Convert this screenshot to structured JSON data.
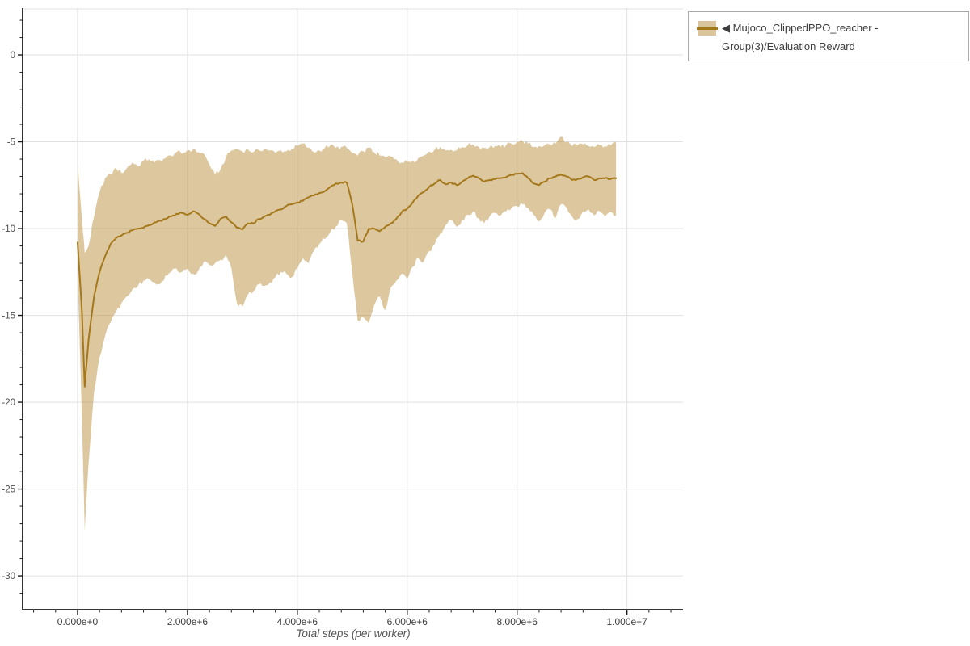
{
  "legend": {
    "icon": "◀",
    "label": "Mujoco_ClippedPPO_reacher - Group(3)/Evaluation Reward"
  },
  "chart_data": {
    "type": "line",
    "title": "",
    "xlabel": "Total steps (per worker)",
    "ylabel": "",
    "grid": true,
    "legend_position": "top-right",
    "xlim_e6": [
      -1.0,
      11.02
    ],
    "ylim": [
      -31.95,
      2.7
    ],
    "x_ticks": {
      "values_e6": [
        0,
        2,
        4,
        6,
        8,
        10
      ],
      "labels": [
        "0.000e+0",
        "2.000e+6",
        "4.000e+6",
        "6.000e+6",
        "8.000e+6",
        "1.000e+7"
      ],
      "minor_step_e6": 0.4
    },
    "y_ticks": {
      "values": [
        0,
        -5,
        -10,
        -15,
        -20,
        -25,
        -30
      ],
      "labels": [
        "0",
        "-5",
        "-10",
        "-15",
        "-20",
        "-25",
        "-30"
      ],
      "minor_step": 1
    },
    "colors": {
      "line": "#a5791b",
      "band_fill": "#b98f3f",
      "band_opacity": 0.5,
      "legend_swatch": "#d9c49c",
      "grid": "#e0e0e0",
      "axis": "#1c1c1c",
      "tick_label_x": "#3d3d3d",
      "tick_label_y": "#4f4f4f",
      "legend_border": "#ababab",
      "legend_text": "#3d3d3d"
    },
    "series": [
      {
        "name": "Mujoco_ClippedPPO_reacher - Group(3)/Evaluation Reward",
        "x_e6": [
          0,
          0.08,
          0.13,
          0.2,
          0.3,
          0.4,
          0.5,
          0.6,
          0.7,
          0.8,
          0.9,
          1.0,
          1.1,
          1.2,
          1.3,
          1.4,
          1.5,
          1.6,
          1.7,
          1.8,
          1.9,
          2.0,
          2.1,
          2.2,
          2.3,
          2.4,
          2.5,
          2.6,
          2.7,
          2.8,
          2.9,
          3.0,
          3.1,
          3.2,
          3.3,
          3.4,
          3.5,
          3.6,
          3.7,
          3.8,
          3.9,
          4.0,
          4.1,
          4.2,
          4.3,
          4.4,
          4.5,
          4.6,
          4.7,
          4.8,
          4.9,
          5.0,
          5.1,
          5.2,
          5.3,
          5.4,
          5.5,
          5.6,
          5.7,
          5.8,
          5.9,
          6.0,
          6.1,
          6.2,
          6.3,
          6.4,
          6.5,
          6.6,
          6.7,
          6.8,
          6.9,
          7.0,
          7.1,
          7.2,
          7.3,
          7.4,
          7.5,
          7.6,
          7.7,
          7.8,
          7.9,
          8.0,
          8.1,
          8.2,
          8.3,
          8.4,
          8.5,
          8.6,
          8.7,
          8.8,
          8.9,
          9.0,
          9.1,
          9.2,
          9.3,
          9.4,
          9.5,
          9.6,
          9.7,
          9.8
        ],
        "mean": [
          -10.8,
          -14.8,
          -19.1,
          -16.4,
          -13.9,
          -12.5,
          -11.6,
          -10.9,
          -10.55,
          -10.4,
          -10.25,
          -10.1,
          -10,
          -9.95,
          -9.8,
          -9.65,
          -9.55,
          -9.45,
          -9.3,
          -9.15,
          -9.1,
          -9.2,
          -9,
          -9.15,
          -9.45,
          -9.7,
          -9.85,
          -9.45,
          -9.3,
          -9.65,
          -9.95,
          -10.05,
          -9.7,
          -9.7,
          -9.45,
          -9.3,
          -9.2,
          -9,
          -8.9,
          -8.7,
          -8.6,
          -8.5,
          -8.4,
          -8.2,
          -8.1,
          -7.95,
          -7.85,
          -7.6,
          -7.4,
          -7.35,
          -7.35,
          -8.6,
          -10.7,
          -10.75,
          -10,
          -10,
          -10.15,
          -9.9,
          -9.7,
          -9.45,
          -9.05,
          -8.85,
          -8.5,
          -8.1,
          -7.9,
          -7.6,
          -7.4,
          -7.2,
          -7.45,
          -7.35,
          -7.5,
          -7.3,
          -7.1,
          -6.95,
          -7.1,
          -7.3,
          -7.2,
          -7.15,
          -7.1,
          -7.05,
          -6.9,
          -6.85,
          -6.8,
          -7.1,
          -7.4,
          -7.5,
          -7.3,
          -7.1,
          -7,
          -6.9,
          -7,
          -7.2,
          -7.15,
          -7.05,
          -7,
          -7.2,
          -7.1,
          -7.1,
          -7.15,
          -7.1
        ],
        "upper": [
          -6.3,
          -9.5,
          -11.4,
          -11,
          -9.3,
          -7.9,
          -7.1,
          -6.9,
          -6.5,
          -6.8,
          -6.5,
          -6.2,
          -6.4,
          -6.1,
          -6,
          -6.2,
          -6.05,
          -5.95,
          -5.8,
          -5.6,
          -5.7,
          -5.5,
          -5.45,
          -5.6,
          -5.7,
          -6.3,
          -6.9,
          -6.6,
          -5.9,
          -5.5,
          -5.4,
          -5.55,
          -5.45,
          -5.6,
          -5.5,
          -5.4,
          -5.5,
          -5.65,
          -5.5,
          -5.55,
          -5.4,
          -5.25,
          -5.1,
          -5.35,
          -5.6,
          -5.5,
          -5.35,
          -5.2,
          -5.35,
          -5.3,
          -5.35,
          -5.65,
          -5.8,
          -5.55,
          -5.35,
          -5.6,
          -5.8,
          -5.9,
          -5.85,
          -6,
          -6.2,
          -6.15,
          -6.1,
          -5.95,
          -5.8,
          -5.55,
          -5.45,
          -5.3,
          -5.5,
          -5.45,
          -5.5,
          -5.3,
          -5.2,
          -5.15,
          -5.3,
          -5.35,
          -5.3,
          -5.25,
          -5.3,
          -5.2,
          -5.1,
          -5,
          -4.95,
          -5.1,
          -5.3,
          -5.25,
          -5.2,
          -5.15,
          -5.1,
          -4.7,
          -5,
          -5.25,
          -5.2,
          -5.15,
          -5.25,
          -5.3,
          -5.2,
          -5.25,
          -5.2,
          -5.05
        ],
        "lower": [
          -12.6,
          -21,
          -27.4,
          -23.5,
          -19.4,
          -17.4,
          -16.2,
          -15.4,
          -14.8,
          -14.3,
          -13.9,
          -13.5,
          -13.3,
          -13,
          -12.9,
          -13.1,
          -13.2,
          -12.7,
          -12.5,
          -12.3,
          -12.5,
          -12.3,
          -12.6,
          -12.4,
          -11.9,
          -12.1,
          -12,
          -11.8,
          -11.5,
          -12.3,
          -14.3,
          -14.5,
          -13.8,
          -13.6,
          -13.2,
          -13.3,
          -13.1,
          -12.8,
          -12.5,
          -12.6,
          -12.8,
          -12.3,
          -11.7,
          -12,
          -11.3,
          -10.9,
          -10.6,
          -10.2,
          -9.9,
          -9.5,
          -9.7,
          -12.5,
          -15.3,
          -15.1,
          -15.45,
          -14.4,
          -13.9,
          -14.7,
          -13.4,
          -13,
          -12.6,
          -12.9,
          -12.2,
          -11.7,
          -11.9,
          -11.3,
          -10.9,
          -10.3,
          -9.8,
          -9.5,
          -9.9,
          -9.5,
          -9.2,
          -9,
          -9.4,
          -9.7,
          -9.3,
          -9.1,
          -9.25,
          -9,
          -8.8,
          -8.7,
          -8.6,
          -8.8,
          -9.2,
          -9.6,
          -9.1,
          -8.9,
          -9.4,
          -8.6,
          -8.8,
          -9.3,
          -9.45,
          -9,
          -8.9,
          -9.25,
          -9,
          -9.3,
          -9.05,
          -9.25
        ]
      }
    ]
  }
}
